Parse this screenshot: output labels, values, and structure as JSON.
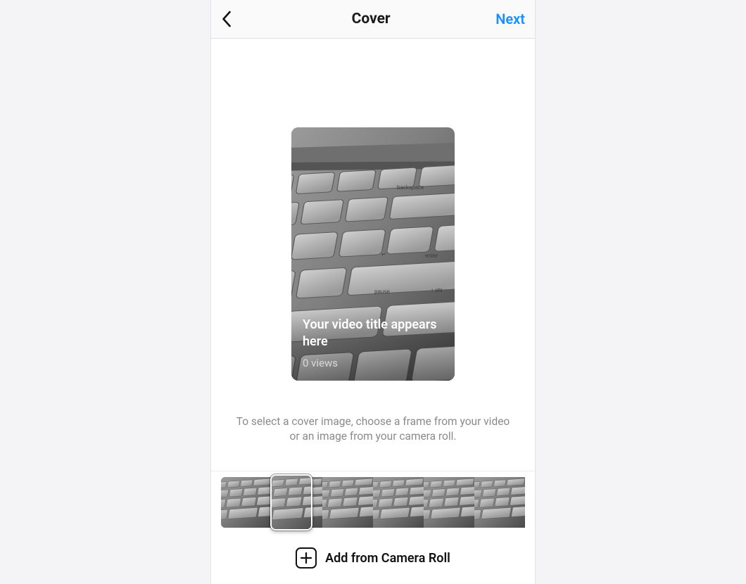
{
  "nav": {
    "title": "Cover",
    "next": "Next"
  },
  "preview": {
    "title": "Your video title appears here",
    "views": "0 views"
  },
  "helper": "To select a cover image, choose a frame from your video or an image from your camera roll.",
  "addFromCameraRoll": "Add from Camera Roll",
  "filmstrip": {
    "frameCount": 6,
    "selectedIndex": 1
  }
}
